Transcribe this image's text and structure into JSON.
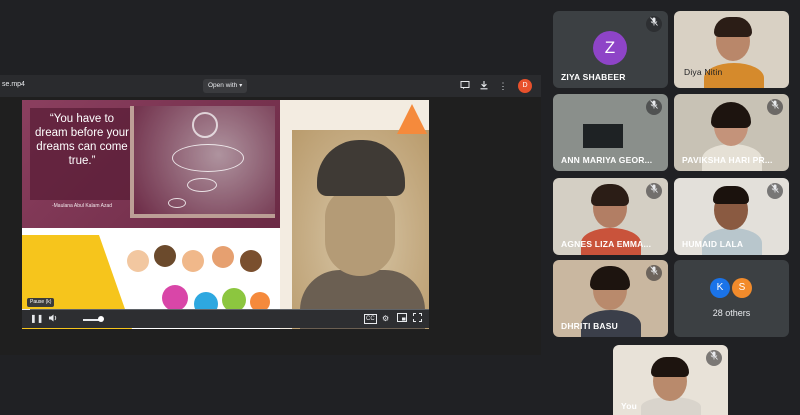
{
  "viewer": {
    "file_name": "se.mp4",
    "open_with_label": "Open with",
    "avatar_letter": "D"
  },
  "video": {
    "quote": "“You have to dream before your dreams can come true.”",
    "quote_author": "-Maulana Abul Kalam Azad",
    "paused_label": "Pause (k)",
    "progress": 0.02
  },
  "participants": [
    {
      "id": "ziya",
      "name": "ZIYA SHABEER",
      "avatar_letter": "Z",
      "avatar_color": "#8e44c7",
      "muted": true
    },
    {
      "id": "diya",
      "name": "Diya Nitin",
      "muted": false
    },
    {
      "id": "ann",
      "name": "ANN MARIYA GEOR...",
      "muted": true
    },
    {
      "id": "paviksha",
      "name": "PAVIKSHA HARI PR...",
      "muted": true
    },
    {
      "id": "agnes",
      "name": "AGNES LIZA EMMA...",
      "muted": true
    },
    {
      "id": "humaid",
      "name": "HUMAID LALA",
      "muted": true
    },
    {
      "id": "dhriti",
      "name": "DHRITI BASU",
      "muted": true
    },
    {
      "id": "self",
      "name": "You",
      "muted": true
    }
  ],
  "others": {
    "label": "28 others",
    "avatars": [
      {
        "letter": "K",
        "color": "#1a73e8"
      },
      {
        "letter": "S",
        "color": "#f28b2b"
      }
    ]
  },
  "icons": {
    "mic_off": "mic-off-icon",
    "comment": "comment-icon",
    "download": "download-icon",
    "more": "more-vert-icon",
    "play": "pause-icon",
    "volume": "volume-icon",
    "cc": "captions-icon",
    "settings": "gear-icon",
    "pip": "picture-in-picture-icon",
    "fullscreen": "fullscreen-icon"
  }
}
